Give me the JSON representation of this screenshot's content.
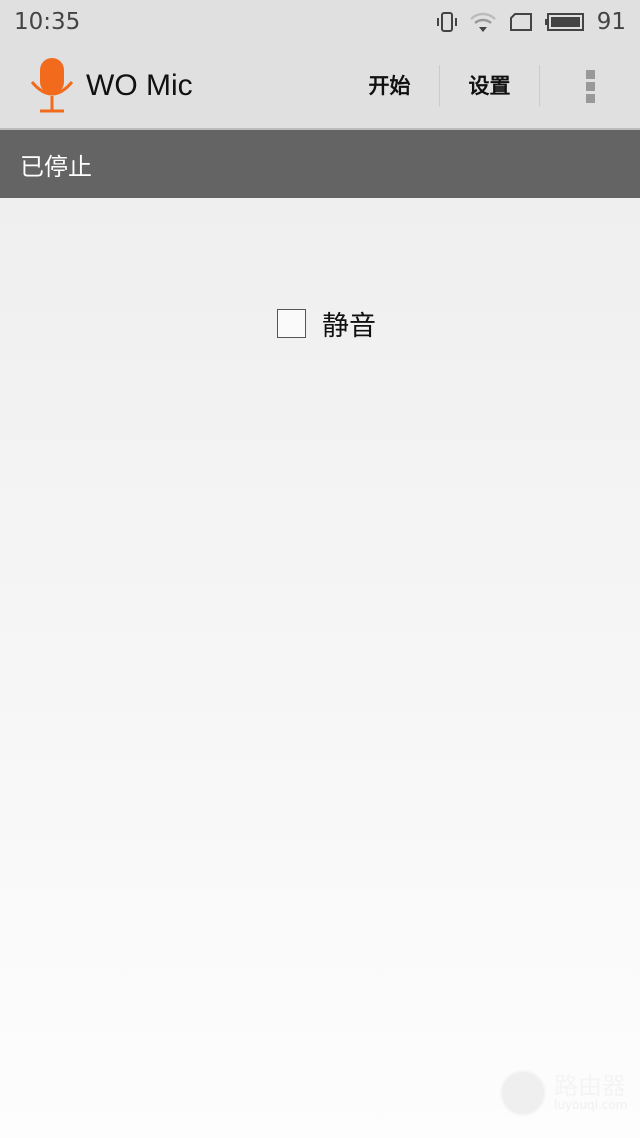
{
  "status_bar": {
    "time": "10:35",
    "battery": "91",
    "icons": [
      "vibrate-icon",
      "wifi-icon",
      "sim-icon",
      "battery-icon"
    ]
  },
  "app_bar": {
    "title": "WO Mic",
    "actions": [
      "开始",
      "设置"
    ],
    "brand_color": "#f26b1d"
  },
  "state": {
    "text": "已停止"
  },
  "mute": {
    "label": "静音",
    "checked": false
  },
  "watermark": {
    "text": "路由器",
    "url": "luyouqi.com"
  }
}
